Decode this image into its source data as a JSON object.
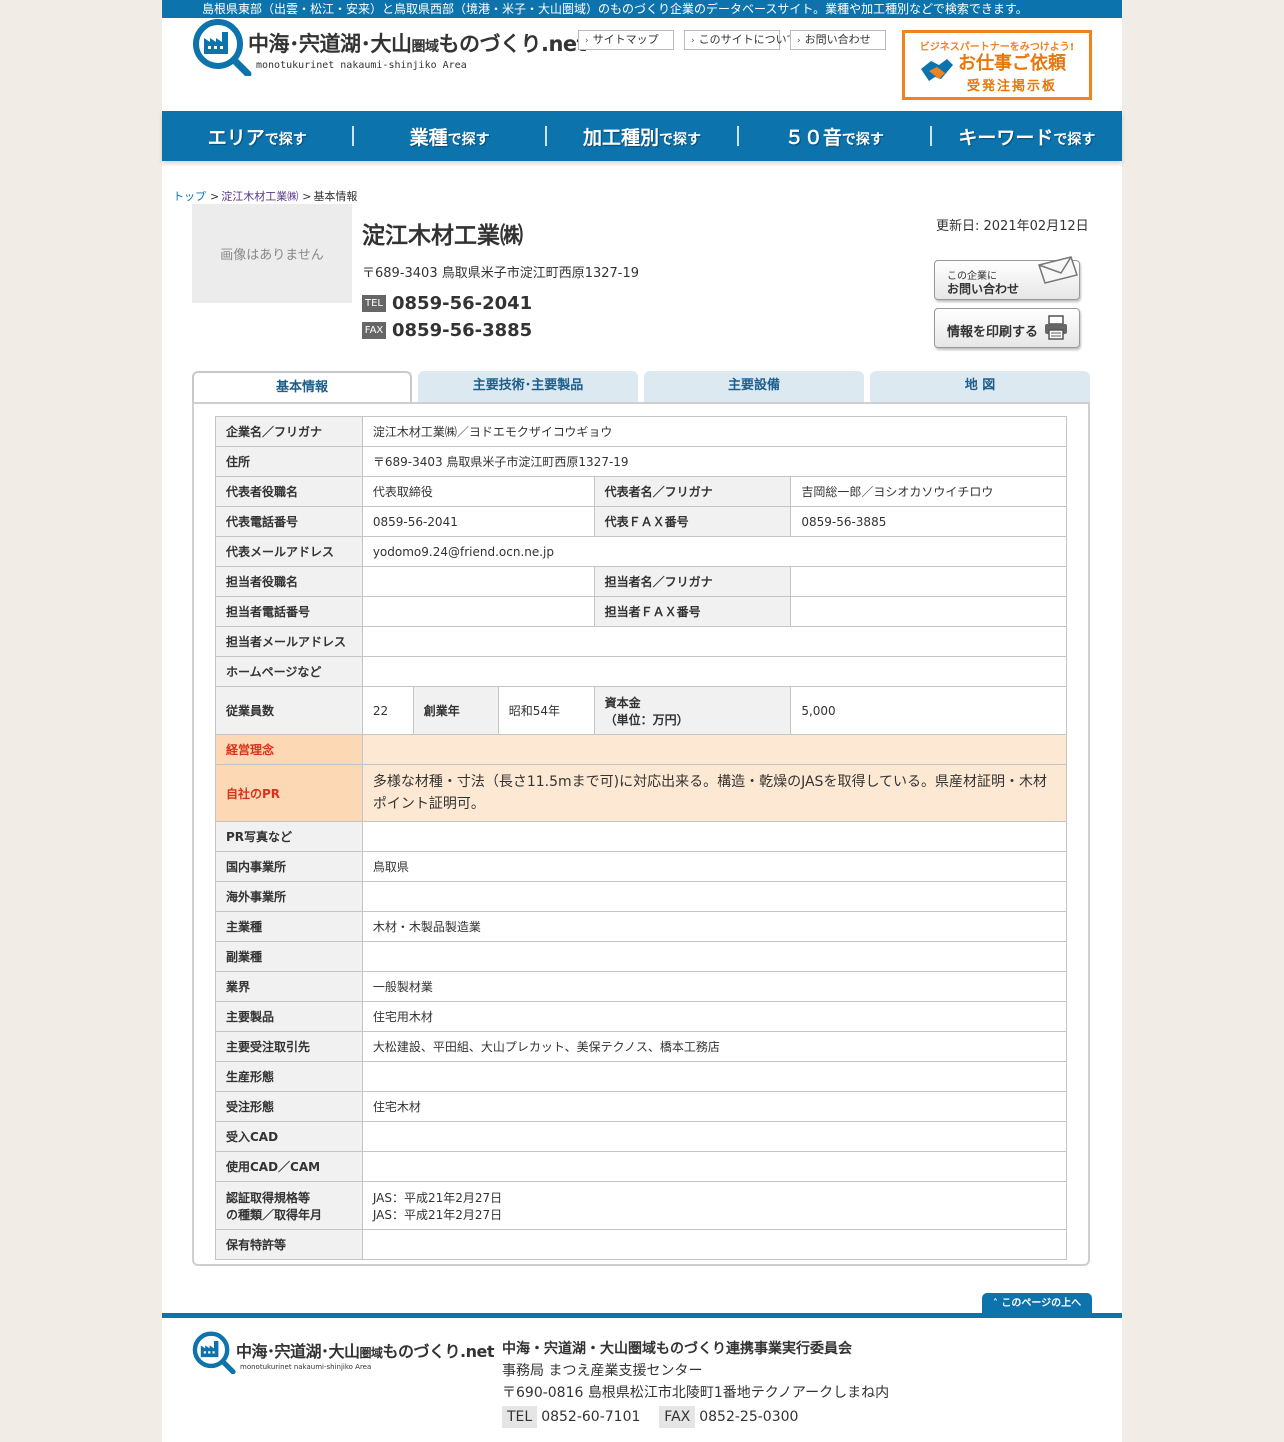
{
  "topbar": {
    "text": "島根県東部（出雲・松江・安来）と鳥取県西部（境港・米子・大山圏域）のものづくり企業のデータベースサイト。業種や加工種別などで検索できます。"
  },
  "header": {
    "logo_title_a": "中海･宍道湖･大山",
    "logo_title_b": "圏域",
    "logo_title_c": "ものづくり.net",
    "logo_sub": "monotukurinet nakaumi-shinjiko Area",
    "subnav": [
      "サイトマップ",
      "このサイトについて",
      "お問い合わせ"
    ],
    "banner": {
      "line1": "ビジネスパートナーをみつけよう!",
      "line2": "お仕事ご依頼",
      "line3": "受発注掲示板"
    }
  },
  "nav": [
    {
      "main": "エリア",
      "sub": "で探す"
    },
    {
      "main": "業種",
      "sub": "で探す"
    },
    {
      "main": "加工種別",
      "sub": "で探す"
    },
    {
      "main": "５０音",
      "sub": "で探す"
    },
    {
      "main": "キーワード",
      "sub": "で探す"
    }
  ],
  "breadcrumb": {
    "home": "トップ",
    "company": "淀江木材工業㈱",
    "current": "基本情報"
  },
  "company": {
    "no_image": "画像はありません",
    "name": "淀江木材工業㈱",
    "address": "〒689-3403 鳥取県米子市淀江町西原1327-19",
    "tel_label": "TEL",
    "tel": "0859-56-2041",
    "fax_label": "FAX",
    "fax": "0859-56-3885",
    "updated": "更新日: 2021年02月12日",
    "contact_btn_line1": "この企業に",
    "contact_btn_line2": "お問い合わせ",
    "print_btn": "情報を印刷する"
  },
  "tabs": [
    "基本情報",
    "主要技術･主要製品",
    "主要設備",
    "地 図"
  ],
  "info": {
    "company_name_label": "企業名／フリガナ",
    "company_name_value": "淀江木材工業㈱／ヨドエモクザイコウギョウ",
    "address_label": "住所",
    "address_value": "〒689-3403 鳥取県米子市淀江町西原1327-19",
    "rep_title_label": "代表者役職名",
    "rep_title_value": "代表取締役",
    "rep_name_label": "代表者名／フリガナ",
    "rep_name_value": "吉岡総一郎／ヨシオカソウイチロウ",
    "rep_tel_label": "代表電話番号",
    "rep_tel_value": "0859-56-2041",
    "rep_fax_label": "代表ＦＡＸ番号",
    "rep_fax_value": "0859-56-3885",
    "rep_mail_label": "代表メールアドレス",
    "rep_mail_value": "yodomo9.24@friend.ocn.ne.jp",
    "staff_title_label": "担当者役職名",
    "staff_title_value": "",
    "staff_name_label": "担当者名／フリガナ",
    "staff_name_value": "",
    "staff_tel_label": "担当者電話番号",
    "staff_tel_value": "",
    "staff_fax_label": "担当者ＦＡＸ番号",
    "staff_fax_value": "",
    "staff_mail_label": "担当者メールアドレス",
    "staff_mail_value": "",
    "homepage_label": "ホームページなど",
    "homepage_value": "",
    "employees_label": "従業員数",
    "employees_value": "22",
    "founded_label": "創業年",
    "founded_value": "昭和54年",
    "capital_label_1": "資本金",
    "capital_label_2": "（単位：万円）",
    "capital_value": "5,000",
    "philosophy_label": "経営理念",
    "philosophy_value": "",
    "pr_label": "自社のPR",
    "pr_value": "多様な材種・寸法（長さ11.5mまで可)に対応出来る。構造・乾燥のJASを取得している。県産材証明・木材ポイント証明可。",
    "pr_photo_label": "PR写真など",
    "pr_photo_value": "",
    "domestic_label": "国内事業所",
    "domestic_value": "鳥取県",
    "overseas_label": "海外事業所",
    "overseas_value": "",
    "main_industry_label": "主業種",
    "main_industry_value": "木材・木製品製造業",
    "sub_industry_label": "副業種",
    "sub_industry_value": "",
    "sector_label": "業界",
    "sector_value": "一般製材業",
    "products_label": "主要製品",
    "products_value": "住宅用木材",
    "clients_label": "主要受注取引先",
    "clients_value": "大松建設、平田組、大山プレカット、美保テクノス、橋本工務店",
    "production_label": "生産形態",
    "production_value": "",
    "order_label": "受注形態",
    "order_value": "住宅木材",
    "cad_in_label": "受入CAD",
    "cad_in_value": "",
    "cad_use_label": "使用CAD／CAM",
    "cad_use_value": "",
    "cert_label_1": "認証取得規格等",
    "cert_label_2": "の種類／取得年月",
    "cert_value_1": "JAS：平成21年2月27日",
    "cert_value_2": "JAS：平成21年2月27日",
    "patent_label": "保有特許等",
    "patent_value": ""
  },
  "footer": {
    "pagetop": "このページの上へ",
    "logo_title_a": "中海･宍道湖･大山",
    "logo_title_b": "圏域",
    "logo_title_c": "ものづくり.net",
    "logo_sub": "monotukurinet nakaumi-shinjiko Area",
    "org": "中海・宍道湖・大山圏域ものづくり連携事業実行委員会",
    "office": "事務局 まつえ産業支援センター",
    "address": "〒690-0816 島根県松江市北陵町1番地テクノアークしまね内",
    "tel_label": "TEL",
    "tel": "0852-60-7101",
    "fax_label": "FAX",
    "fax": "0852-25-0300"
  },
  "colors": {
    "brand_blue": "#0d73ad",
    "accent_orange": "#f08320",
    "pr_red": "#d9331a",
    "background": "#f1ede6"
  }
}
